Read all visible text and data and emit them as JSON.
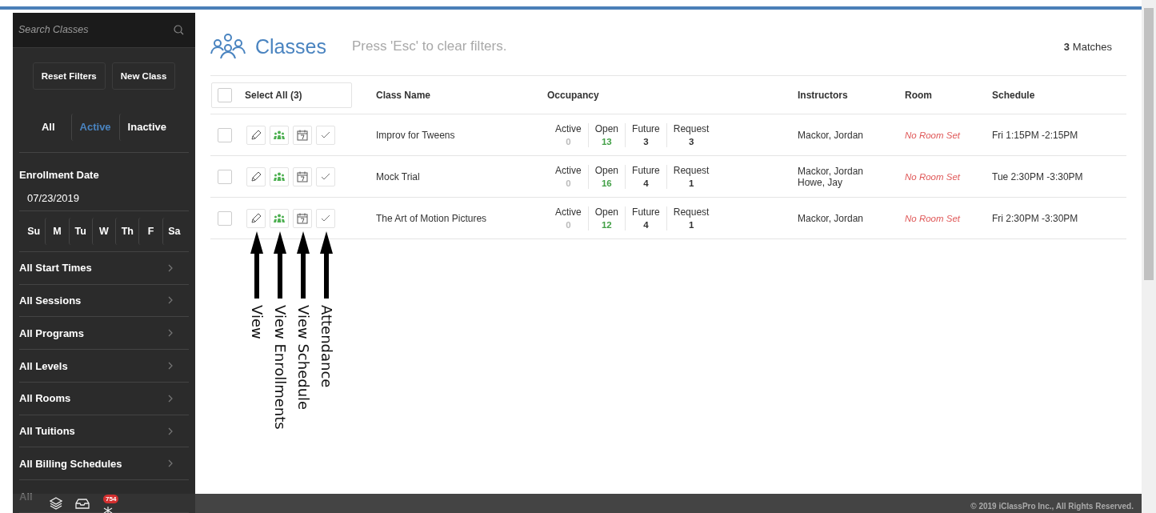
{
  "sidebar": {
    "search": {
      "placeholder": "Search Classes"
    },
    "buttons": [
      "Reset Filters",
      "New Class"
    ],
    "status_tabs": [
      {
        "label": "All",
        "selected": false
      },
      {
        "label": "Active",
        "selected": true
      },
      {
        "label": "Inactive",
        "selected": false
      }
    ],
    "enrollment_date": {
      "label": "Enrollment Date",
      "value": "07/23/2019"
    },
    "days": [
      "Su",
      "M",
      "Tu",
      "W",
      "Th",
      "F",
      "Sa"
    ],
    "filters": [
      "All Start Times",
      "All Sessions",
      "All Programs",
      "All Levels",
      "All Rooms",
      "All Tuitions",
      "All Billing Schedules",
      "All"
    ],
    "bottom_bar": {
      "badge": "754"
    }
  },
  "header": {
    "title": "Classes",
    "hint": "Press 'Esc' to clear filters.",
    "matches_count": "3",
    "matches_label": "Matches"
  },
  "table": {
    "select_all": {
      "label": "Select All (3)",
      "checked": false
    },
    "columns": [
      "Class Name",
      "Occupancy",
      "Instructors",
      "Room",
      "Schedule"
    ],
    "rows": [
      {
        "checked": false,
        "name": "Improv for Tweens",
        "occupancy": [
          {
            "label": "Active",
            "value": "0",
            "color": "#bbbbbb"
          },
          {
            "label": "Open",
            "value": "13",
            "color": "#43a047"
          },
          {
            "label": "Future",
            "value": "3",
            "color": "#333333"
          },
          {
            "label": "Request",
            "value": "3",
            "color": "#333333"
          }
        ],
        "instructors": [
          "Mackor, Jordan"
        ],
        "room": "No Room Set",
        "schedule": "Fri 1:15PM -2:15PM"
      },
      {
        "checked": false,
        "name": "Mock Trial",
        "occupancy": [
          {
            "label": "Active",
            "value": "0",
            "color": "#bbbbbb"
          },
          {
            "label": "Open",
            "value": "16",
            "color": "#43a047"
          },
          {
            "label": "Future",
            "value": "4",
            "color": "#333333"
          },
          {
            "label": "Request",
            "value": "1",
            "color": "#333333"
          }
        ],
        "instructors": [
          "Mackor, Jordan",
          "Howe, Jay"
        ],
        "room": "No Room Set",
        "schedule": "Tue 2:30PM -3:30PM"
      },
      {
        "checked": false,
        "name": "The Art of Motion Pictures",
        "occupancy": [
          {
            "label": "Active",
            "value": "0",
            "color": "#bbbbbb"
          },
          {
            "label": "Open",
            "value": "12",
            "color": "#43a047"
          },
          {
            "label": "Future",
            "value": "4",
            "color": "#333333"
          },
          {
            "label": "Request",
            "value": "1",
            "color": "#333333"
          }
        ],
        "instructors": [
          "Mackor, Jordan"
        ],
        "room": "No Room Set",
        "schedule": "Fri 2:30PM -3:30PM"
      }
    ]
  },
  "annotations": [
    "View",
    "View Enrollments",
    "View Schedule",
    "Attendance"
  ],
  "footer": "© 2019 iClassPro Inc., All Rights Reserved."
}
